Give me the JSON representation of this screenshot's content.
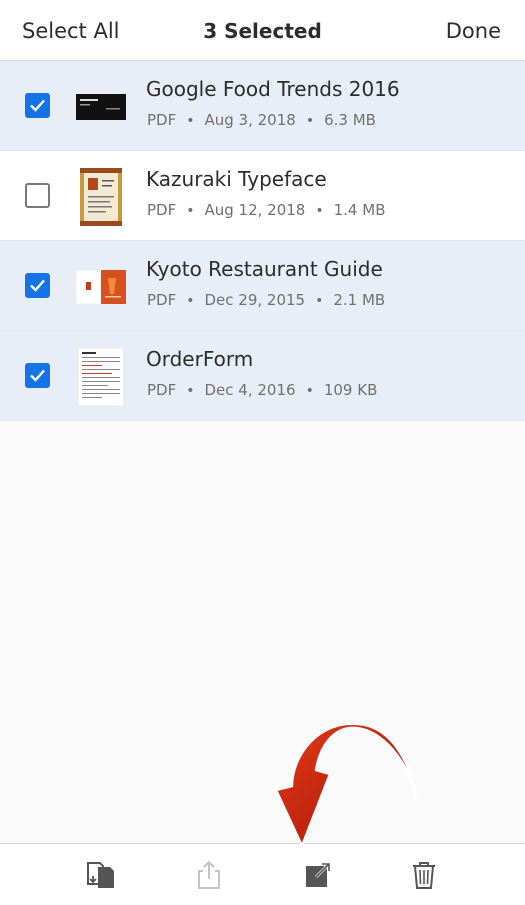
{
  "header": {
    "select_all": "Select All",
    "title": "3 Selected",
    "done": "Done"
  },
  "files": [
    {
      "name": "Google Food Trends 2016",
      "type": "PDF",
      "date": "Aug 3, 2018",
      "size": "6.3 MB",
      "selected": true
    },
    {
      "name": "Kazuraki Typeface",
      "type": "PDF",
      "date": "Aug 12, 2018",
      "size": "1.4 MB",
      "selected": false
    },
    {
      "name": "Kyoto Restaurant Guide",
      "type": "PDF",
      "date": "Dec 29, 2015",
      "size": "2.1 MB",
      "selected": true
    },
    {
      "name": "OrderForm",
      "type": "PDF",
      "date": "Dec 4, 2016",
      "size": "109 KB",
      "selected": true
    }
  ],
  "meta_separator": "•",
  "toolbar": {
    "icons": [
      "combine-files-icon",
      "share-icon",
      "open-in-icon",
      "trash-icon"
    ],
    "share_enabled": false
  },
  "colors": {
    "accent": "#1473e6",
    "selected_row": "#e8eef8",
    "arrow": "#cc1a00"
  }
}
